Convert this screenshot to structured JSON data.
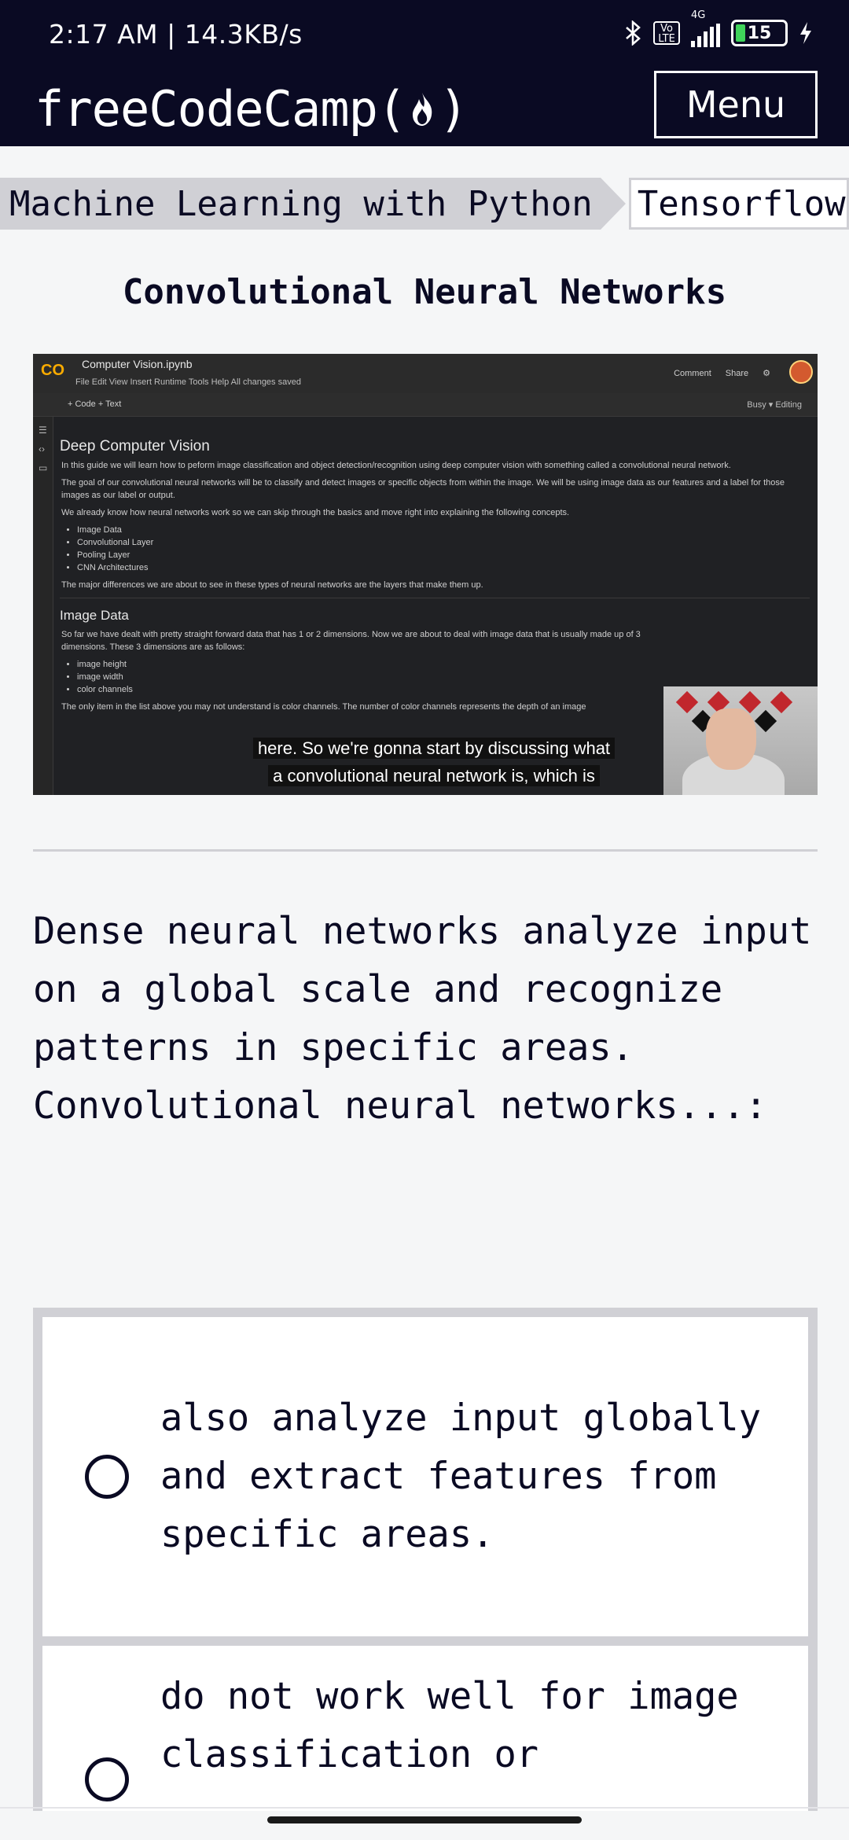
{
  "status_bar": {
    "time": "2:17 AM | 14.3KB/s",
    "network": "4G",
    "volte": "Vo LTE",
    "battery": "15"
  },
  "nav": {
    "logo_text": "freeCodeCamp(",
    "logo_close": ")",
    "menu_label": "Menu"
  },
  "breadcrumb": {
    "parent": "Machine Learning with Python",
    "current": "Tensorflow"
  },
  "lesson_title": "Convolutional Neural Networks",
  "video": {
    "notebook_name": "Computer Vision.ipynb",
    "menu": "File   Edit   View   Insert   Runtime   Tools   Help   All changes saved",
    "actions": [
      "Comment",
      "Share"
    ],
    "toolbar_left": "+ Code   + Text",
    "toolbar_right": "Busy ▾    Editing",
    "section_title": "Deep Computer Vision",
    "p1": "In this guide we will learn how to peform image classification and object detection/recognition using deep computer vision with something called a convolutional neural network.",
    "p2": "The goal of our convolutional neural networks will be to classify and detect images or specific objects from within the image. We will be using image data as our features and a label for those images as our label or output.",
    "p3": "We already know how neural networks work so we can skip through the basics and move right into explaining the following concepts.",
    "concepts": [
      "Image Data",
      "Convolutional Layer",
      "Pooling Layer",
      "CNN Architectures"
    ],
    "p4": "The major differences we are about to see in these types of neural networks are the layers that make them up.",
    "section2_title": "Image Data",
    "p5": "So far we have dealt with pretty straight forward data that has 1 or 2 dimensions. Now we are about to deal with image data that is usually made up of 3 dimensions. These 3 dimensions are as follows:",
    "dims": [
      "image height",
      "image width",
      "color channels"
    ],
    "p6": "The only item in the list above you may not understand is color channels. The number of color channels represents the depth of an image",
    "caption_line1": "here. So we're gonna start by discussing what",
    "caption_line2": "a convolutional neural network is, which is"
  },
  "question": "Dense neural networks analyze input on a global scale and recognize patterns in specific areas. Convolutional neural networks...:",
  "answers": [
    "also analyze input globally and extract features from specific areas.",
    "do not work well for image classification or"
  ],
  "colors": {
    "nav_bg": "#0a0a23",
    "page_bg": "#f5f6f7",
    "gray": "#d0d0d5"
  }
}
